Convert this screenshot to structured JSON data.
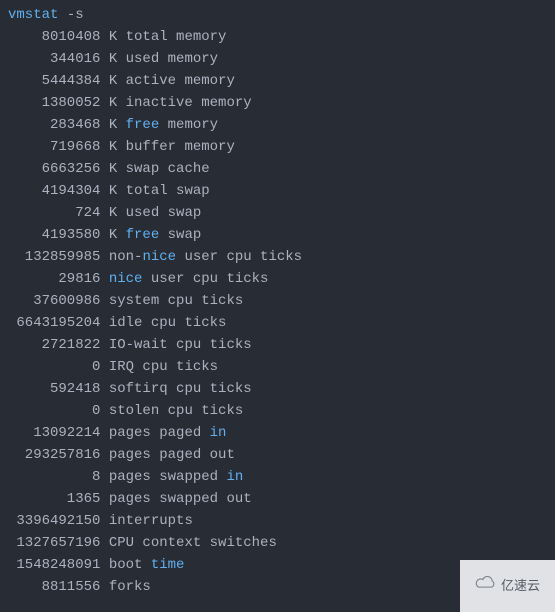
{
  "command": {
    "name": "vmstat",
    "arg": "-s"
  },
  "lines": [
    {
      "num": "8010408",
      "unit": "K",
      "pre": "total ",
      "hl": "",
      "post": "memory"
    },
    {
      "num": "344016",
      "unit": "K",
      "pre": "used ",
      "hl": "",
      "post": "memory"
    },
    {
      "num": "5444384",
      "unit": "K",
      "pre": "active ",
      "hl": "",
      "post": "memory"
    },
    {
      "num": "1380052",
      "unit": "K",
      "pre": "inactive ",
      "hl": "",
      "post": "memory"
    },
    {
      "num": "283468",
      "unit": "K",
      "pre": "",
      "hl": "free",
      "post": " memory"
    },
    {
      "num": "719668",
      "unit": "K",
      "pre": "buffer ",
      "hl": "",
      "post": "memory"
    },
    {
      "num": "6663256",
      "unit": "K",
      "pre": "swap ",
      "hl": "",
      "post": "cache"
    },
    {
      "num": "4194304",
      "unit": "K",
      "pre": "total ",
      "hl": "",
      "post": "swap"
    },
    {
      "num": "724",
      "unit": "K",
      "pre": "used ",
      "hl": "",
      "post": "swap"
    },
    {
      "num": "4193580",
      "unit": "K",
      "pre": "",
      "hl": "free",
      "post": " swap"
    },
    {
      "num": "132859985",
      "unit": "",
      "pre": "non-",
      "hl": "nice",
      "post": " user cpu ticks"
    },
    {
      "num": "29816",
      "unit": "",
      "pre": "",
      "hl": "nice",
      "post": " user cpu ticks"
    },
    {
      "num": "37600986",
      "unit": "",
      "pre": "system cpu ticks",
      "hl": "",
      "post": ""
    },
    {
      "num": "6643195204",
      "unit": "",
      "pre": "idle cpu ticks",
      "hl": "",
      "post": ""
    },
    {
      "num": "2721822",
      "unit": "",
      "pre": "IO-wait cpu ticks",
      "hl": "",
      "post": ""
    },
    {
      "num": "0",
      "unit": "",
      "pre": "IRQ cpu ticks",
      "hl": "",
      "post": ""
    },
    {
      "num": "592418",
      "unit": "",
      "pre": "softirq cpu ticks",
      "hl": "",
      "post": ""
    },
    {
      "num": "0",
      "unit": "",
      "pre": "stolen cpu ticks",
      "hl": "",
      "post": ""
    },
    {
      "num": "13092214",
      "unit": "",
      "pre": "pages paged ",
      "hl": "in",
      "post": ""
    },
    {
      "num": "293257816",
      "unit": "",
      "pre": "pages paged out",
      "hl": "",
      "post": ""
    },
    {
      "num": "8",
      "unit": "",
      "pre": "pages swapped ",
      "hl": "in",
      "post": ""
    },
    {
      "num": "1365",
      "unit": "",
      "pre": "pages swapped out",
      "hl": "",
      "post": ""
    },
    {
      "num": "3396492150",
      "unit": "",
      "pre": "interrupts",
      "hl": "",
      "post": ""
    },
    {
      "num": "1327657196",
      "unit": "",
      "pre": "CPU context switches",
      "hl": "",
      "post": ""
    },
    {
      "num": "1548248091",
      "unit": "",
      "pre": "boot ",
      "hl": "time",
      "post": ""
    },
    {
      "num": "8811556",
      "unit": "",
      "pre": "forks",
      "hl": "",
      "post": ""
    }
  ],
  "watermark": {
    "text": "亿速云"
  }
}
